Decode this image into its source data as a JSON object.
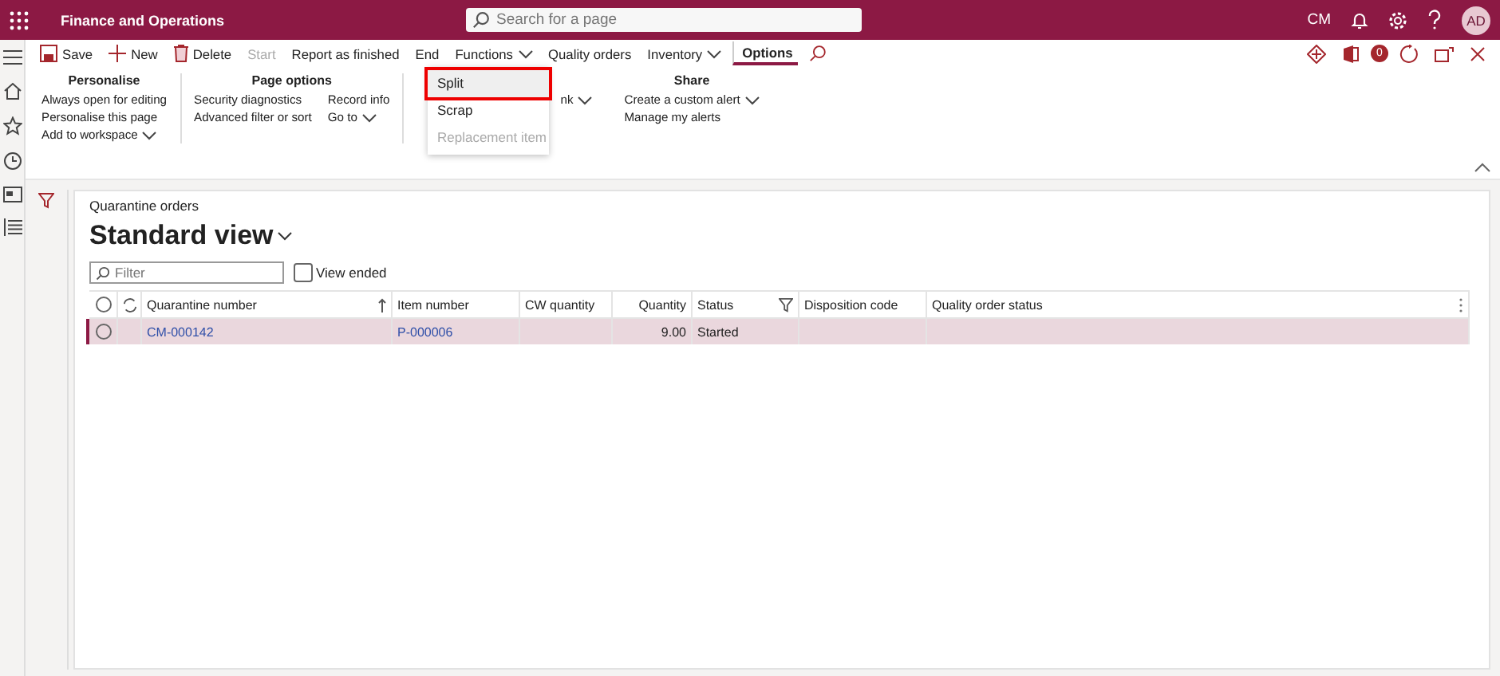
{
  "topbar": {
    "app_title": "Finance and Operations",
    "search": {
      "placeholder": "Search for a page"
    },
    "company": "CM",
    "avatar": "AD"
  },
  "actions": [
    {
      "label": "Save",
      "kind": "save",
      "disabled": false,
      "dropdown": false,
      "selected": false
    },
    {
      "label": "New",
      "kind": "new",
      "disabled": false,
      "dropdown": false,
      "selected": false
    },
    {
      "label": "Delete",
      "kind": "delete",
      "disabled": false,
      "dropdown": false,
      "selected": false
    },
    {
      "label": "Start",
      "kind": "text",
      "disabled": true,
      "dropdown": false,
      "selected": false
    },
    {
      "label": "Report as finished",
      "kind": "text",
      "disabled": false,
      "dropdown": false,
      "selected": false
    },
    {
      "label": "End",
      "kind": "text",
      "disabled": false,
      "dropdown": false,
      "selected": false
    },
    {
      "label": "Functions",
      "kind": "text",
      "disabled": false,
      "dropdown": true,
      "selected": false
    },
    {
      "label": "Quality orders",
      "kind": "text",
      "disabled": false,
      "dropdown": false,
      "selected": false
    },
    {
      "label": "Inventory",
      "kind": "text",
      "disabled": false,
      "dropdown": true,
      "selected": false
    },
    {
      "label": "Options",
      "kind": "text",
      "disabled": false,
      "dropdown": false,
      "selected": true
    }
  ],
  "ribbon": [
    {
      "title": "Personalise",
      "columns": [
        [
          {
            "label": "Always open for editing",
            "dropdown": false
          },
          {
            "label": "Personalise this page",
            "dropdown": false
          },
          {
            "label": "Add to workspace",
            "dropdown": true
          }
        ]
      ]
    },
    {
      "title": "Page options",
      "columns": [
        [
          {
            "label": "Security diagnostics",
            "dropdown": false
          },
          {
            "label": "Advanced filter or sort",
            "dropdown": false
          }
        ],
        [
          {
            "label": "Record info",
            "dropdown": false
          },
          {
            "label": "Go to",
            "dropdown": true
          }
        ]
      ]
    },
    {
      "columns": [
        [
          {
            "label": "nk",
            "dropdown": true
          }
        ]
      ]
    },
    {
      "title": "Share",
      "columns": [
        [
          {
            "label": "Create a custom alert",
            "dropdown": true
          },
          {
            "label": "Manage my alerts",
            "dropdown": false
          }
        ]
      ]
    }
  ],
  "menu": [
    {
      "label": "Split",
      "selected": true,
      "disabled": false
    },
    {
      "label": "Scrap",
      "selected": false,
      "disabled": false
    },
    {
      "label": "Replacement item",
      "selected": false,
      "disabled": true
    }
  ],
  "notification_count": "0",
  "page": {
    "caption": "Quarantine orders",
    "view": "Standard view",
    "filter": {
      "placeholder": "Filter"
    },
    "view_ended": {
      "label": "View ended",
      "checked": false
    }
  },
  "table": {
    "all_selected": false,
    "columns": [
      {
        "label": "Quarantine number",
        "kind": "text",
        "sort": true,
        "filter": false
      },
      {
        "label": "Item number",
        "kind": "text",
        "sort": false,
        "filter": false
      },
      {
        "label": "CW quantity",
        "kind": "text",
        "sort": false,
        "filter": false
      },
      {
        "label": "Quantity",
        "kind": "number",
        "sort": false,
        "filter": false
      },
      {
        "label": "Status",
        "kind": "text",
        "sort": false,
        "filter": true
      },
      {
        "label": "Disposition code",
        "kind": "text",
        "sort": false,
        "filter": false
      },
      {
        "label": "Quality order status",
        "kind": "text",
        "sort": false,
        "filter": false
      }
    ],
    "rows": [
      {
        "selected": true,
        "cells": [
          {
            "text": "CM-000142",
            "link": true
          },
          {
            "text": "P-000006",
            "link": true
          },
          {},
          {
            "text": "9.00",
            "link": false
          },
          {
            "text": "Started",
            "link": false
          },
          {},
          {}
        ]
      }
    ]
  }
}
